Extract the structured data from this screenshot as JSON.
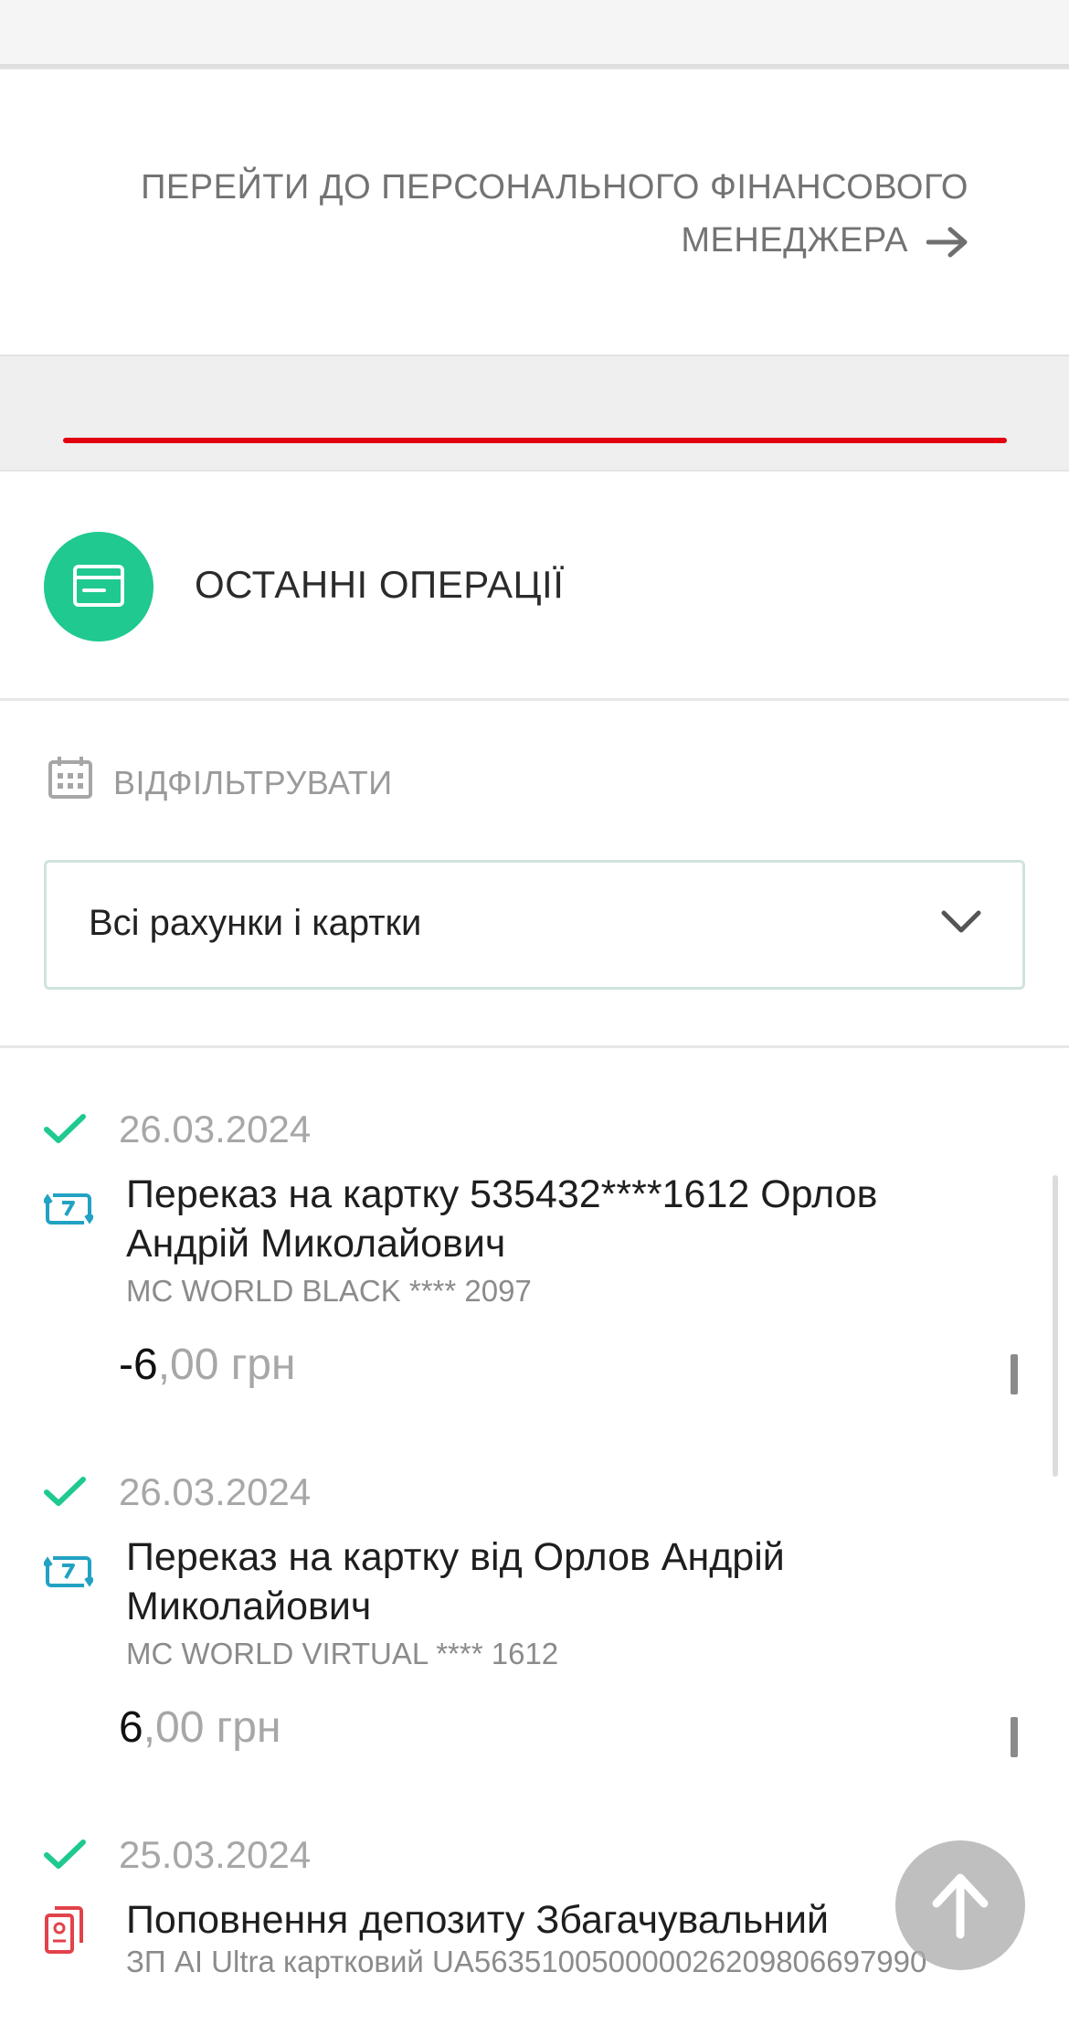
{
  "pfm": {
    "link_text": "Перейти до персонального фінансового менеджера",
    "arrow_icon": "arrow-right-icon"
  },
  "colors": {
    "accent_green": "#1fc98f",
    "brand_red": "#e3000f",
    "transfer_teal": "#22a2c3",
    "deposit_red": "#e2424a"
  },
  "operations": {
    "title": "Останні операції",
    "icon": "card-icon"
  },
  "filter": {
    "label": "Відфільтрувати",
    "icon": "calendar-icon",
    "select_value": "Всі рахунки і картки"
  },
  "transactions": [
    {
      "date": "26.03.2024",
      "title": "Переказ на картку 535432****1612 Орлов Андрій Миколайович",
      "card": "MC WORLD BLACK **** 2097",
      "amount_int": "-6",
      "amount_frac": ",00 грн",
      "icon": "transfer-icon"
    },
    {
      "date": "26.03.2024",
      "title": "Переказ на картку від Орлов Андрій Миколайович",
      "card": "MC WORLD VIRTUAL **** 1612",
      "amount_int": "6",
      "amount_frac": ",00 грн",
      "icon": "transfer-icon"
    },
    {
      "date": "25.03.2024",
      "title": "Поповнення депозиту Збагачувальний",
      "card": "ЗП AI Ultra картковий UA563510050000026209806697990",
      "icon": "deposit-icon"
    }
  ],
  "fab": {
    "icon": "arrow-up-icon"
  }
}
